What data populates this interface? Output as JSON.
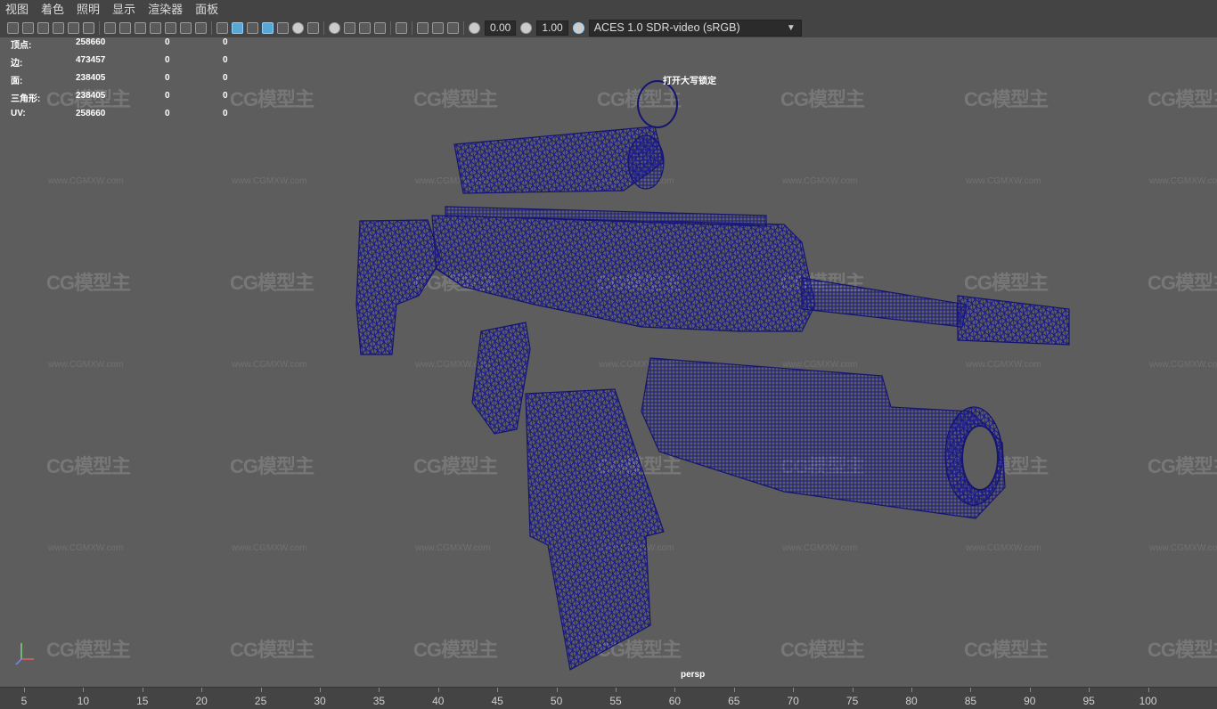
{
  "menu": [
    "视图",
    "着色",
    "照明",
    "显示",
    "渲染器",
    "面板"
  ],
  "toolbar": {
    "exposure": "0.00",
    "gamma": "1.00",
    "color_space": "ACES 1.0 SDR-video (sRGB)"
  },
  "hud": {
    "rows": [
      {
        "label": "顶点:",
        "v1": "258660",
        "v2": "0",
        "v3": "0"
      },
      {
        "label": "边:",
        "v1": "473457",
        "v2": "0",
        "v3": "0"
      },
      {
        "label": "面:",
        "v1": "238405",
        "v2": "0",
        "v3": "0"
      },
      {
        "label": "三角形:",
        "v1": "238405",
        "v2": "0",
        "v3": "0"
      },
      {
        "label": "UV:",
        "v1": "258660",
        "v2": "0",
        "v3": "0"
      }
    ]
  },
  "viewport": {
    "caps_lock": "打开大写锁定",
    "camera": "persp",
    "watermark_logo": "CG模型主",
    "watermark_url": "www.CGMXW.com",
    "wire_color": "#1a1a8c"
  },
  "timeline": {
    "ticks": [
      "5",
      "10",
      "15",
      "20",
      "25",
      "30",
      "35",
      "40",
      "45",
      "50",
      "55",
      "60",
      "65",
      "70",
      "75",
      "80",
      "85",
      "90",
      "95",
      "100"
    ]
  }
}
